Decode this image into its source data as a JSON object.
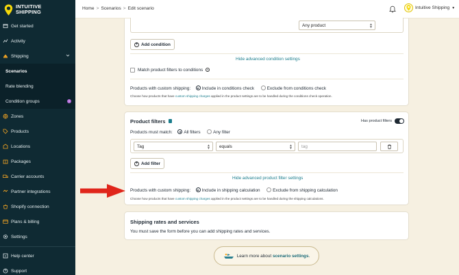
{
  "brand": {
    "line1": "INTUITIVE",
    "line2": "SHIPPING"
  },
  "sidebar": {
    "items": [
      {
        "label": "Get started",
        "icon": "box-icon"
      },
      {
        "label": "Activity",
        "icon": "activity-icon"
      },
      {
        "label": "Shipping",
        "icon": "shipping-icon"
      },
      {
        "label": "Scenarios",
        "icon": ""
      },
      {
        "label": "Rate blending",
        "icon": ""
      },
      {
        "label": "Condition groups",
        "icon": "",
        "badge": "i"
      },
      {
        "label": "Zones",
        "icon": "globe-icon"
      },
      {
        "label": "Products",
        "icon": "tag-icon"
      },
      {
        "label": "Locations",
        "icon": "warehouse-icon"
      },
      {
        "label": "Packages",
        "icon": "package-icon"
      },
      {
        "label": "Carrier accounts",
        "icon": "truck-icon"
      },
      {
        "label": "Partner integrations",
        "icon": "partner-icon"
      },
      {
        "label": "Shopify connection",
        "icon": "shopify-icon"
      },
      {
        "label": "Plans & billing",
        "icon": "billing-icon"
      },
      {
        "label": "Settings",
        "icon": "gear-icon"
      }
    ],
    "bottom": [
      {
        "label": "Help center",
        "icon": "help-icon"
      },
      {
        "label": "Support",
        "icon": "support-icon"
      }
    ]
  },
  "topbar": {
    "breadcrumb": [
      "Home",
      "Scenarios",
      "Edit scenario"
    ],
    "account": "Intuitive Shipping"
  },
  "conditions": {
    "product_select": "Any product",
    "add_condition": "Add condition",
    "hide_advanced": "Hide advanced condition settings",
    "match_filters_label": "Match product filters to conditions",
    "custom_shipping_label": "Products with custom shipping:",
    "include_option": "Include in conditions check",
    "exclude_option": "Exclude from conditions check",
    "note_prefix": "Choose how products that have ",
    "note_link": "custom shipping charges",
    "note_suffix": " applied in the product settings are to be handled during the conditions check operation."
  },
  "product_filters": {
    "title": "Product filters",
    "has_filters_label": "Has product filters",
    "must_match_label": "Products must match:",
    "all_filters": "All filters",
    "any_filter": "Any filter",
    "filter_field": "Tag",
    "filter_operator": "equals",
    "filter_value_placeholder": "tag",
    "add_filter": "Add filter",
    "hide_advanced": "Hide advanced product filter settings",
    "custom_shipping_label": "Products with custom shipping:",
    "include_option": "Include in shipping calculation",
    "exclude_option": "Exclude from shipping calculation",
    "note_prefix": "Choose how products that have ",
    "note_link": "custom shipping charges",
    "note_suffix": " applied in the product settings are to be handled during the shipping calculations."
  },
  "rates": {
    "title": "Shipping rates and services",
    "message": "You must save the form before you can add shipping rates and services."
  },
  "learn": {
    "prefix": "Learn more about ",
    "link": "scenario settings",
    "suffix": "."
  },
  "colors": {
    "sidebar": "#0f2a33",
    "background": "#f6f0e1",
    "link": "#1a7d8c",
    "arrow": "#e0261b"
  }
}
